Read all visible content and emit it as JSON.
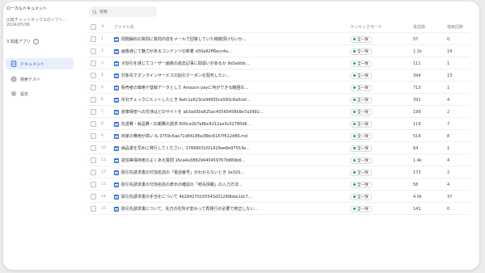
{
  "sidebar": {
    "org_name": "ローカルドキュメント",
    "dataset_name": "比較チャットボックスのソフト…",
    "dataset_date": "2024/05/06",
    "app_count": "3 関連アプリ",
    "nav": [
      {
        "label": "ドキュメント",
        "icon": "document-icon"
      },
      {
        "label": "検索テスト",
        "icon": "target-icon"
      },
      {
        "label": "設定",
        "icon": "gear-icon"
      }
    ]
  },
  "search": {
    "placeholder": "検索"
  },
  "table": {
    "headers": {
      "num": "#",
      "name": "ファイル名",
      "status": "ランキングモード",
      "words": "単語数",
      "hits": "検索回数"
    },
    "rows": [
      {
        "num": "1",
        "name": "問題解約の質問に質問内容をメールで回答していた時期頂けないか…",
        "status": "全一致",
        "words": "57",
        "hits": "0"
      },
      {
        "num": "2",
        "name": "画像通じて魅力があるコンテンツの新着 d30a92ff6ecc4a…",
        "status": "全一致",
        "words": "1.1k",
        "hits": "19"
      },
      {
        "num": "3",
        "name": "ポ割引を通じてユーザー画像の過去記事に間違いがあるか 9d1ebbb…",
        "status": "全一致",
        "words": "111",
        "hits": "1"
      },
      {
        "num": "4",
        "name": "対象先でオンラインサービスの割引クーポンを配布したい…",
        "status": "全一致",
        "words": "394",
        "hits": "13"
      },
      {
        "num": "5",
        "name": "販売者の価格や登録データとして Amazon payに何ができる範囲の…",
        "status": "全一致",
        "words": "713",
        "hits": "1"
      },
      {
        "num": "6",
        "name": "反社チェックにヒットしたとき 8afc1a623ce94930ce593c6a0cef…",
        "status": "全一致",
        "words": "391",
        "hits": "4"
      },
      {
        "num": "7",
        "name": "倉庫保管への交渉はどのサイトを ab3ad30a825ac45565458b9e7a3992…",
        "status": "全一致",
        "words": "199",
        "hits": "2"
      },
      {
        "num": "8",
        "name": "先送費・就品費・広報費の請求 600ce2b7e8bc4212ae3c02780d6…",
        "status": "全一致",
        "words": "119",
        "hits": "7"
      },
      {
        "num": "9",
        "name": "商家の費用が高い IL 0759c6ae71d84186a38bc6167f612d89.md",
        "status": "全一致",
        "words": "514",
        "hits": "8"
      },
      {
        "num": "10",
        "name": "納品書を早めに発行してください。17668031f01429ee6e97553e…",
        "status": "全一致",
        "words": "64",
        "hits": "1"
      },
      {
        "num": "11",
        "name": "返信等保持者のよくある質問 16ca4a38829440459767b889b6…",
        "status": "全一致",
        "words": "1.4k",
        "hits": "4"
      },
      {
        "num": "12",
        "name": "取引先請求書の付加名前の「電話番号」がわからないとき 2e320…",
        "status": "全一致",
        "words": "173",
        "hits": "2"
      },
      {
        "num": "13",
        "name": "取引先請求書の付加名前の表示の確認の「宛先情報」の入力方法…",
        "status": "全一致",
        "words": "58",
        "hits": "4"
      },
      {
        "num": "14",
        "name": "取引先請求書の手当をについて 4b184270105543d31299bbe1dc7…",
        "status": "全一致",
        "words": "4.0k",
        "hits": "37"
      },
      {
        "num": "15",
        "name": "取引先請求書について、先方の住所が変わって再発行が必要で修正しない…",
        "status": "全一致",
        "words": "141",
        "hits": "0"
      }
    ]
  }
}
